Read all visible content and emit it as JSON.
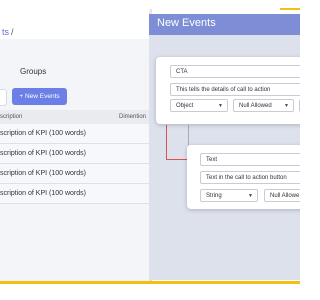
{
  "app": {
    "breadcrumb_text": "ts",
    "breadcrumb_sep": "/",
    "groups_title": "Groups",
    "new_events_button": "+ New Events",
    "table": {
      "columns": [
        "scription",
        "Dimention"
      ],
      "rows": [
        "scription of KPI (100 words)",
        "scription of KPI (100 words)",
        "scription of KPI (100 words)",
        "scription of KPI (100 words)"
      ]
    }
  },
  "modal": {
    "title": "New Events",
    "card1": {
      "name_value": "CTA",
      "description_value": "This tells the details of call to action",
      "type_value": "Object",
      "null_value": "Null Allowed",
      "caret_icon": "chevron-down-icon"
    },
    "card2": {
      "name_value": "Text",
      "description_value": "Text in the call to action button",
      "type_value": "String",
      "null_value": "Null Allowe",
      "caret_icon": "chevron-down-icon"
    }
  },
  "colors": {
    "accent": "#6b7fe6",
    "header": "#7d8ed6",
    "connector": "#d9534f",
    "bottom_bar": "#f3c012"
  }
}
